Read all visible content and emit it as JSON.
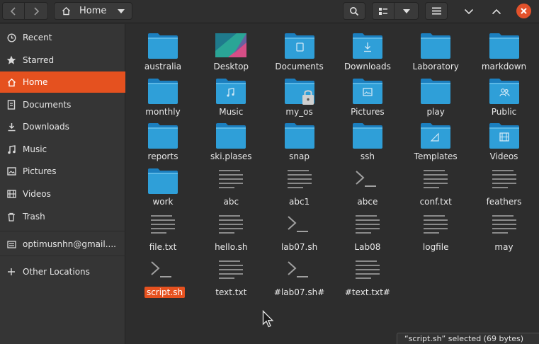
{
  "header": {
    "path_label": "Home"
  },
  "sidebar": {
    "items": [
      {
        "label": "Recent",
        "icon": "clock-icon"
      },
      {
        "label": "Starred",
        "icon": "star-icon"
      },
      {
        "label": "Home",
        "icon": "home-icon",
        "active": true
      },
      {
        "label": "Documents",
        "icon": "document-icon"
      },
      {
        "label": "Downloads",
        "icon": "download-icon"
      },
      {
        "label": "Music",
        "icon": "music-icon"
      },
      {
        "label": "Pictures",
        "icon": "picture-icon"
      },
      {
        "label": "Videos",
        "icon": "video-icon"
      },
      {
        "label": "Trash",
        "icon": "trash-icon"
      },
      {
        "label": "optimusnhn@gmail....",
        "icon": "online-account-icon"
      },
      {
        "label": "Other Locations",
        "icon": "plus-icon"
      }
    ]
  },
  "files": [
    {
      "name": "australia",
      "type": "folder"
    },
    {
      "name": "Desktop",
      "type": "desktop"
    },
    {
      "name": "Documents",
      "type": "folder-documents"
    },
    {
      "name": "Downloads",
      "type": "folder-downloads"
    },
    {
      "name": "Laboratory",
      "type": "folder"
    },
    {
      "name": "markdown",
      "type": "folder"
    },
    {
      "name": "monthly",
      "type": "folder"
    },
    {
      "name": "Music",
      "type": "folder-music"
    },
    {
      "name": "my_os",
      "type": "folder-locked"
    },
    {
      "name": "Pictures",
      "type": "folder-pictures"
    },
    {
      "name": "play",
      "type": "folder"
    },
    {
      "name": "Public",
      "type": "folder-public"
    },
    {
      "name": "reports",
      "type": "folder"
    },
    {
      "name": "ski.plases",
      "type": "folder"
    },
    {
      "name": "snap",
      "type": "folder"
    },
    {
      "name": "ssh",
      "type": "folder"
    },
    {
      "name": "Templates",
      "type": "folder-templates"
    },
    {
      "name": "Videos",
      "type": "folder-videos"
    },
    {
      "name": "work",
      "type": "folder"
    },
    {
      "name": "abc",
      "type": "text"
    },
    {
      "name": "abc1",
      "type": "text"
    },
    {
      "name": "abce",
      "type": "script"
    },
    {
      "name": "conf.txt",
      "type": "text"
    },
    {
      "name": "feathers",
      "type": "text"
    },
    {
      "name": "file.txt",
      "type": "text"
    },
    {
      "name": "hello.sh",
      "type": "text"
    },
    {
      "name": "lab07.sh",
      "type": "script"
    },
    {
      "name": "Lab08",
      "type": "text"
    },
    {
      "name": "logfile",
      "type": "text"
    },
    {
      "name": "may",
      "type": "text"
    },
    {
      "name": "script.sh",
      "type": "script",
      "selected": true
    },
    {
      "name": "text.txt",
      "type": "text"
    },
    {
      "name": "#lab07.sh#",
      "type": "script"
    },
    {
      "name": "#text.txt#",
      "type": "text"
    }
  ],
  "status": {
    "text": "“script.sh” selected  (69 bytes)"
  },
  "colors": {
    "accent": "#e5511f",
    "folder": "#2f9fd8",
    "folder_tab": "#1b7fbf"
  }
}
